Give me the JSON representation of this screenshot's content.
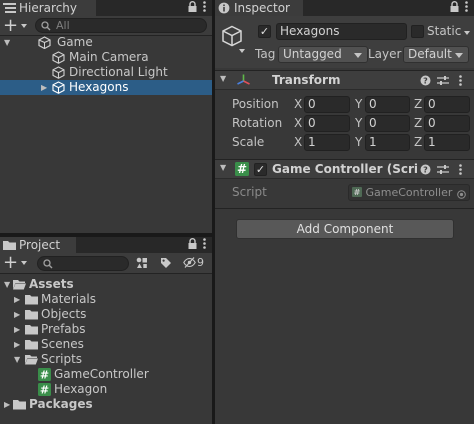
{
  "hierarchy": {
    "tab_label": "Hierarchy",
    "add_label": "+",
    "search_placeholder": "All",
    "items": [
      {
        "label": "Game"
      },
      {
        "label": "Main Camera"
      },
      {
        "label": "Directional Light"
      },
      {
        "label": "Hexagons"
      }
    ]
  },
  "project": {
    "tab_label": "Project",
    "add_label": "+",
    "hidden_count": "9",
    "tree": [
      {
        "label": "Assets"
      },
      {
        "label": "Materials"
      },
      {
        "label": "Objects"
      },
      {
        "label": "Prefabs"
      },
      {
        "label": "Scenes"
      },
      {
        "label": "Scripts"
      },
      {
        "label": "GameController"
      },
      {
        "label": "Hexagon"
      },
      {
        "label": "Packages"
      }
    ]
  },
  "inspector": {
    "tab_label": "Inspector",
    "object_name": "Hexagons",
    "static_label": "Static",
    "tag_label": "Tag",
    "tag_value": "Untagged",
    "layer_label": "Layer",
    "layer_value": "Default",
    "transform": {
      "title": "Transform",
      "rows": [
        {
          "label": "Position",
          "x": "0",
          "y": "0",
          "z": "0"
        },
        {
          "label": "Rotation",
          "x": "0",
          "y": "0",
          "z": "0"
        },
        {
          "label": "Scale",
          "x": "1",
          "y": "1",
          "z": "1"
        }
      ],
      "axis_x": "X",
      "axis_y": "Y",
      "axis_z": "Z"
    },
    "component": {
      "title": "Game Controller (Script)",
      "script_label": "Script",
      "script_value": "GameController"
    },
    "add_component_label": "Add Component"
  },
  "colors": {
    "selection": "#2c5d87",
    "panel": "#383838",
    "script_icon": "#3a8e4a"
  }
}
